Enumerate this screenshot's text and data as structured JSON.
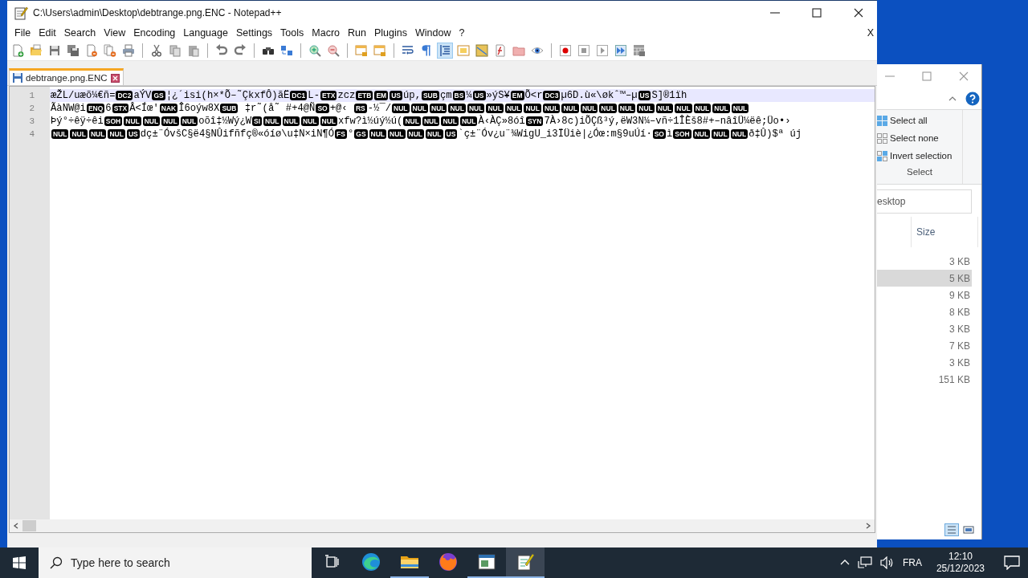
{
  "notepad": {
    "title": "C:\\Users\\admin\\Desktop\\debtrange.png.ENC - Notepad++",
    "menu": [
      "File",
      "Edit",
      "Search",
      "View",
      "Encoding",
      "Language",
      "Settings",
      "Tools",
      "Macro",
      "Run",
      "Plugins",
      "Window",
      "?"
    ],
    "menu_close": "X",
    "toolbar_buttons": [
      {
        "pressed": false
      },
      {
        "pressed": false
      },
      {
        "pressed": false
      },
      {
        "pressed": false
      },
      {
        "pressed": false
      },
      {
        "pressed": false
      },
      {
        "pressed": false
      },
      {
        "pressed": false
      },
      {
        "pressed": false
      },
      {
        "pressed": false
      },
      {
        "pressed": false
      },
      {
        "pressed": false
      },
      {
        "pressed": false
      },
      {
        "pressed": false
      },
      {
        "pressed": false
      },
      {
        "pressed": false
      },
      {
        "pressed": false
      },
      {
        "pressed": false
      },
      {
        "pressed": false
      },
      {
        "pressed": false
      },
      {
        "pressed": true
      },
      {
        "pressed": false
      },
      {
        "pressed": false
      },
      {
        "pressed": false
      },
      {
        "pressed": false
      },
      {
        "pressed": false
      },
      {
        "pressed": false
      },
      {
        "pressed": false
      },
      {
        "pressed": false
      },
      {
        "pressed": false
      },
      {
        "pressed": false
      }
    ],
    "tabs": [
      {
        "label": "debtrange.png.ENC",
        "selected": true
      }
    ],
    "lines": [
      {
        "number": "1",
        "current": true,
        "segments": [
          {
            "kind": "text",
            "text": "æŽL/uæõ¼€ñ="
          },
          {
            "kind": "ctrl",
            "text": "DC2"
          },
          {
            "kind": "text",
            "text": "aÝV"
          },
          {
            "kind": "ctrl",
            "text": "GS"
          },
          {
            "kind": "text",
            "text": "¦¿´isi(h×*Õ–˜ÇkxfÔ)ãË"
          },
          {
            "kind": "ctrl",
            "text": "DC1"
          },
          {
            "kind": "text",
            "text": "L-"
          },
          {
            "kind": "ctrl",
            "text": "ETX"
          },
          {
            "kind": "text",
            "text": "zcz"
          },
          {
            "kind": "ctrl",
            "text": "ETB"
          },
          {
            "kind": "ctrl",
            "text": "EM"
          },
          {
            "kind": "ctrl",
            "text": "US"
          },
          {
            "kind": "text",
            "text": "úp,"
          },
          {
            "kind": "ctrl",
            "text": "SUB"
          },
          {
            "kind": "text",
            "text": "çm"
          },
          {
            "kind": "ctrl",
            "text": "BS"
          },
          {
            "kind": "text",
            "text": "¼"
          },
          {
            "kind": "ctrl",
            "text": "US"
          },
          {
            "kind": "text",
            "text": "»ýS¥"
          },
          {
            "kind": "ctrl",
            "text": "EM"
          },
          {
            "kind": "text",
            "text": "Õ<r"
          },
          {
            "kind": "ctrl",
            "text": "DC3"
          },
          {
            "kind": "text",
            "text": "µ6D.ù«\\økˆ™–µ"
          },
          {
            "kind": "ctrl",
            "text": "US"
          },
          {
            "kind": "text",
            "text": "S]®1ïh"
          }
        ]
      },
      {
        "number": "2",
        "current": false,
        "segments": [
          {
            "kind": "text",
            "text": "ÃàNW@i"
          },
          {
            "kind": "ctrl",
            "text": "ENQ"
          },
          {
            "kind": "text",
            "text": "6"
          },
          {
            "kind": "ctrl",
            "text": "STX"
          },
          {
            "kind": "text",
            "text": "Â<Íœ'"
          },
          {
            "kind": "ctrl",
            "text": "NAK"
          },
          {
            "kind": "text",
            "text": "Î6oýw8X"
          },
          {
            "kind": "ctrl",
            "text": "SUB"
          },
          {
            "kind": "text",
            "text": " ‡r˜(å˜ #+4@Ñ"
          },
          {
            "kind": "ctrl",
            "text": "SO"
          },
          {
            "kind": "text",
            "text": "+@‹ "
          },
          {
            "kind": "ctrl",
            "text": "RS"
          },
          {
            "kind": "text",
            "text": "-½¯/"
          },
          {
            "kind": "ctrl",
            "text": "NUL"
          },
          {
            "kind": "ctrl",
            "text": "NUL"
          },
          {
            "kind": "ctrl",
            "text": "NUL"
          },
          {
            "kind": "ctrl",
            "text": "NUL"
          },
          {
            "kind": "ctrl",
            "text": "NUL"
          },
          {
            "kind": "ctrl",
            "text": "NUL"
          },
          {
            "kind": "ctrl",
            "text": "NUL"
          },
          {
            "kind": "ctrl",
            "text": "NUL"
          },
          {
            "kind": "ctrl",
            "text": "NUL"
          },
          {
            "kind": "ctrl",
            "text": "NUL"
          },
          {
            "kind": "ctrl",
            "text": "NUL"
          },
          {
            "kind": "ctrl",
            "text": "NUL"
          },
          {
            "kind": "ctrl",
            "text": "NUL"
          },
          {
            "kind": "ctrl",
            "text": "NUL"
          },
          {
            "kind": "ctrl",
            "text": "NUL"
          },
          {
            "kind": "ctrl",
            "text": "NUL"
          },
          {
            "kind": "ctrl",
            "text": "NUL"
          },
          {
            "kind": "ctrl",
            "text": "NUL"
          },
          {
            "kind": "ctrl",
            "text": "NUL"
          }
        ]
      },
      {
        "number": "3",
        "current": false,
        "segments": [
          {
            "kind": "text",
            "text": "Þý°÷êÿ÷êi"
          },
          {
            "kind": "ctrl",
            "text": "SOH"
          },
          {
            "kind": "ctrl",
            "text": "NUL"
          },
          {
            "kind": "ctrl",
            "text": "NUL"
          },
          {
            "kind": "ctrl",
            "text": "NUL"
          },
          {
            "kind": "ctrl",
            "text": "NUL"
          },
          {
            "kind": "text",
            "text": "oõî‡½Wý¿W"
          },
          {
            "kind": "ctrl",
            "text": "SI"
          },
          {
            "kind": "ctrl",
            "text": "NUL"
          },
          {
            "kind": "ctrl",
            "text": "NUL"
          },
          {
            "kind": "ctrl",
            "text": "NUL"
          },
          {
            "kind": "ctrl",
            "text": "NUL"
          },
          {
            "kind": "text",
            "text": "xfw?ì½úý½ú("
          },
          {
            "kind": "ctrl",
            "text": "NUL"
          },
          {
            "kind": "ctrl",
            "text": "NUL"
          },
          {
            "kind": "ctrl",
            "text": "NUL"
          },
          {
            "kind": "ctrl",
            "text": "NUL"
          },
          {
            "kind": "text",
            "text": "À‹ÀÇ»8óî"
          },
          {
            "kind": "ctrl",
            "text": "SYN"
          },
          {
            "kind": "text",
            "text": "7À›8c)iÕÇß³ý,ëW3N¼–vñ÷1ÎÈš8#+–nâîÜ¼ëê;Üo•›"
          }
        ]
      },
      {
        "number": "4",
        "current": false,
        "segments": [
          {
            "kind": "ctrl",
            "text": "NUL"
          },
          {
            "kind": "ctrl",
            "text": "NUL"
          },
          {
            "kind": "ctrl",
            "text": "NUL"
          },
          {
            "kind": "ctrl",
            "text": "NUL"
          },
          {
            "kind": "ctrl",
            "text": "US"
          },
          {
            "kind": "text",
            "text": "dç±¨ÓvšC§ë4§NÛifñfç®«óíø\\u‡N×iN¶Ó"
          },
          {
            "kind": "ctrl",
            "text": "FS"
          },
          {
            "kind": "text",
            "text": "°"
          },
          {
            "kind": "ctrl",
            "text": "GS"
          },
          {
            "kind": "ctrl",
            "text": "NUL"
          },
          {
            "kind": "ctrl",
            "text": "NUL"
          },
          {
            "kind": "ctrl",
            "text": "NUL"
          },
          {
            "kind": "ctrl",
            "text": "NUL"
          },
          {
            "kind": "ctrl",
            "text": "US"
          },
          {
            "kind": "text",
            "text": "`ç±¨Óv¿u¨¾WigU_i3ÏÜiè|¿Óœ:m§9uÚí·"
          },
          {
            "kind": "ctrl",
            "text": "SO"
          },
          {
            "kind": "text",
            "text": "ì"
          },
          {
            "kind": "ctrl",
            "text": "SOH"
          },
          {
            "kind": "ctrl",
            "text": "NUL"
          },
          {
            "kind": "ctrl",
            "text": "NUL"
          },
          {
            "kind": "ctrl",
            "text": "NUL"
          },
          {
            "kind": "text",
            "text": "ð‡Û)$ª új"
          }
        ]
      }
    ]
  },
  "explorer": {
    "ribbon_items": [
      {
        "label": "Select all"
      },
      {
        "label": "Select none"
      },
      {
        "label": "Invert selection"
      }
    ],
    "group_label": "Select",
    "address": "esktop",
    "column": "Size",
    "rows": [
      {
        "size": "3 KB",
        "selected": false
      },
      {
        "size": "5 KB",
        "selected": true
      },
      {
        "size": "9 KB",
        "selected": false
      },
      {
        "size": "8 KB",
        "selected": false
      },
      {
        "size": "3 KB",
        "selected": false
      },
      {
        "size": "7 KB",
        "selected": false
      },
      {
        "size": "3 KB",
        "selected": false
      },
      {
        "size": "151 KB",
        "selected": false
      }
    ]
  },
  "taskbar": {
    "search_placeholder": "Type here to search",
    "apps": [
      {
        "running": false,
        "active": false
      },
      {
        "running": true,
        "active": false
      },
      {
        "running": false,
        "active": false
      },
      {
        "running": true,
        "active": false
      },
      {
        "running": true,
        "active": true
      }
    ],
    "language": "FRA",
    "time": "12:10",
    "date": "25/12/2023"
  }
}
